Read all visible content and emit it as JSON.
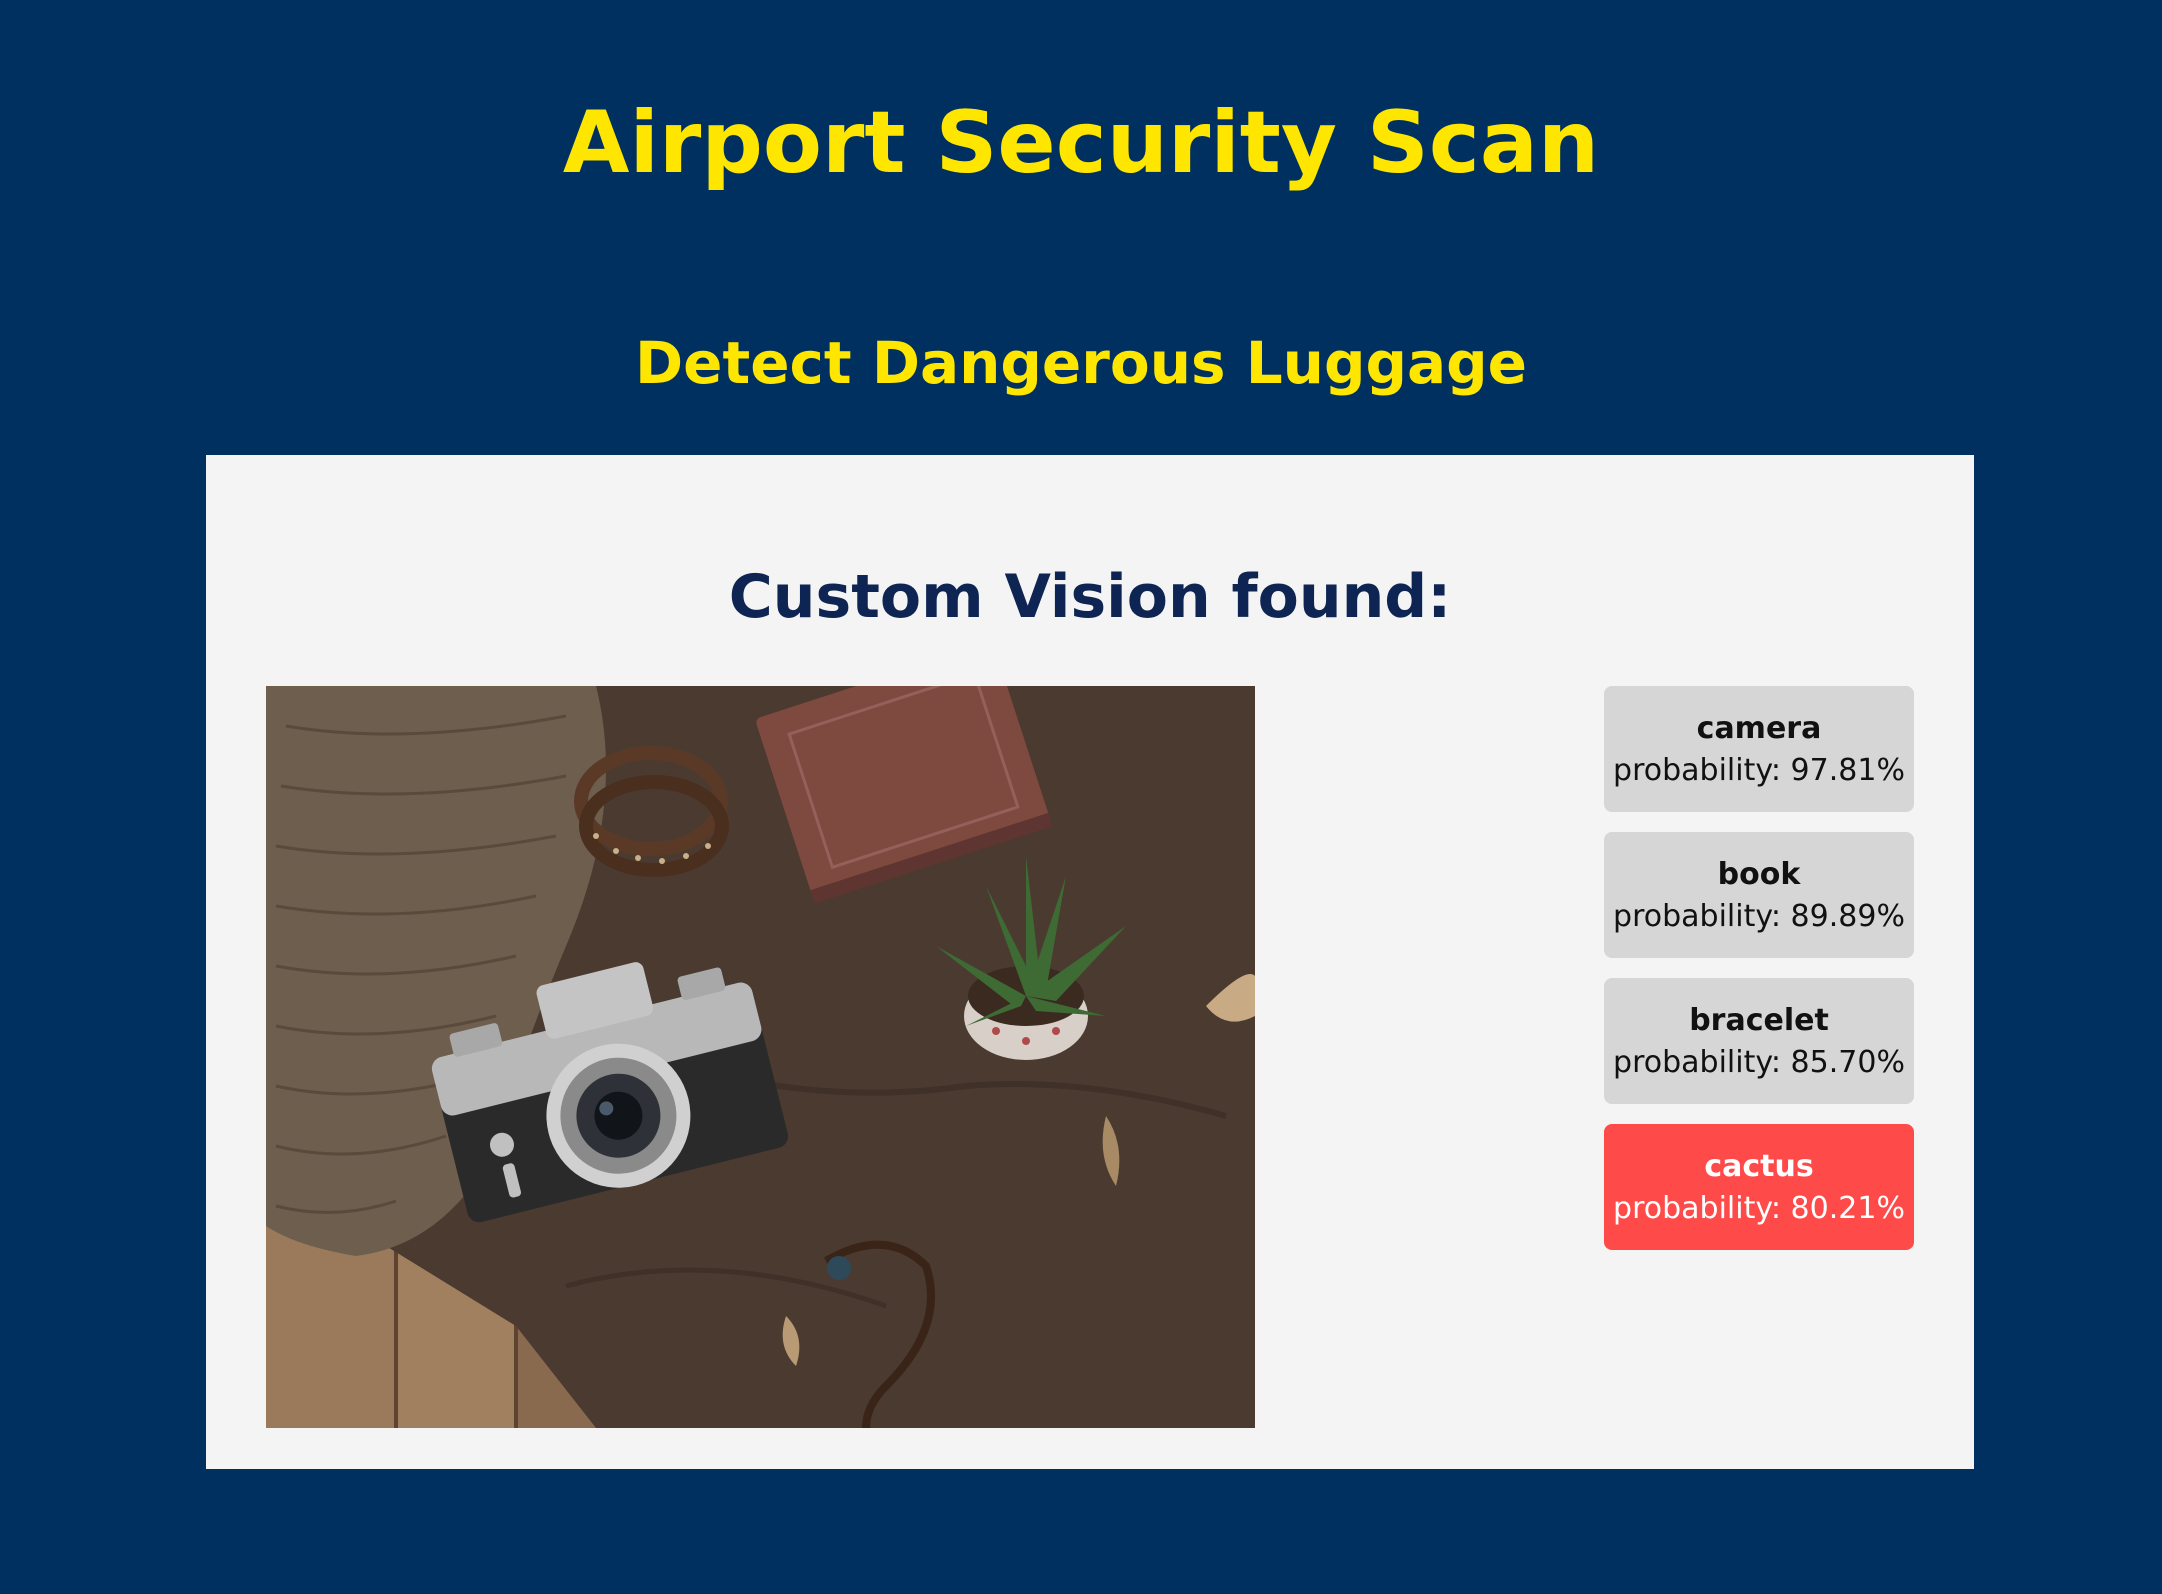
{
  "header": {
    "title": "Airport Security Scan",
    "subtitle": "Detect Dangerous Luggage"
  },
  "results_panel": {
    "heading": "Custom Vision found:",
    "photo_description": "flat lay of a vintage camera, book, bracelet, potted cactus and knitted sweater on brown cloth",
    "predictions": [
      {
        "label": "camera",
        "probability_text": "probability: 97.81%",
        "probability": 97.81,
        "dangerous": false
      },
      {
        "label": "book",
        "probability_text": "probability: 89.89%",
        "probability": 89.89,
        "dangerous": false
      },
      {
        "label": "bracelet",
        "probability_text": "probability: 85.70%",
        "probability": 85.7,
        "dangerous": false
      },
      {
        "label": "cactus",
        "probability_text": "probability: 80.21%",
        "probability": 80.21,
        "dangerous": true
      }
    ]
  },
  "colors": {
    "background": "#003060",
    "title": "#FFE600",
    "panel": "#F4F4F4",
    "heading": "#0E2452",
    "card": "#D6D6D6",
    "danger_card": "#FF4A4A"
  }
}
